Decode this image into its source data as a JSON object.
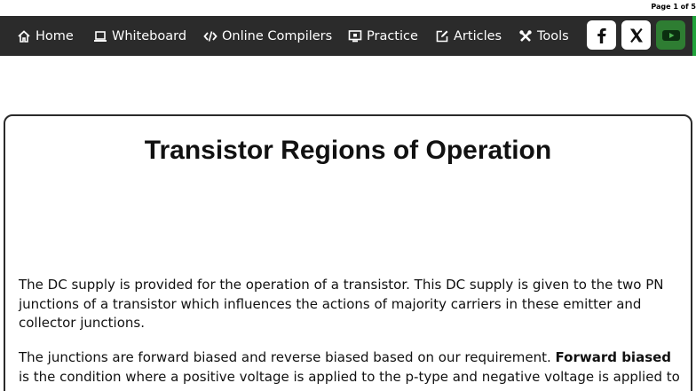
{
  "page_indicator": "Page 1 of 5",
  "nav": {
    "items": [
      {
        "label": "Home",
        "icon": "home-icon"
      },
      {
        "label": "Whiteboard",
        "icon": "laptop-icon"
      },
      {
        "label": "Online Compilers",
        "icon": "code-icon"
      },
      {
        "label": "Practice",
        "icon": "monitor-icon"
      },
      {
        "label": "Articles",
        "icon": "edit-icon"
      },
      {
        "label": "Tools",
        "icon": "tools-icon"
      }
    ],
    "social": [
      {
        "name": "facebook",
        "glyph": "f"
      },
      {
        "name": "x",
        "glyph": "X"
      },
      {
        "name": "youtube",
        "glyph": "▶"
      }
    ]
  },
  "article": {
    "title": "Transistor Regions of Operation",
    "para1": "The DC supply is provided for the operation of a transistor. This DC supply is given to the two PN junctions of a transistor which influences the actions of majority carriers in these emitter and collector junctions.",
    "para2_start": "The junctions are forward biased and reverse biased based on our requirement.",
    "para2_bold": "Forward biased",
    "para2_end": "is the condition where a positive voltage is applied to the p-type and negative voltage is applied to"
  },
  "colors": {
    "nav_bg": "#2b2b2b",
    "accent_green": "#1fa33a"
  }
}
